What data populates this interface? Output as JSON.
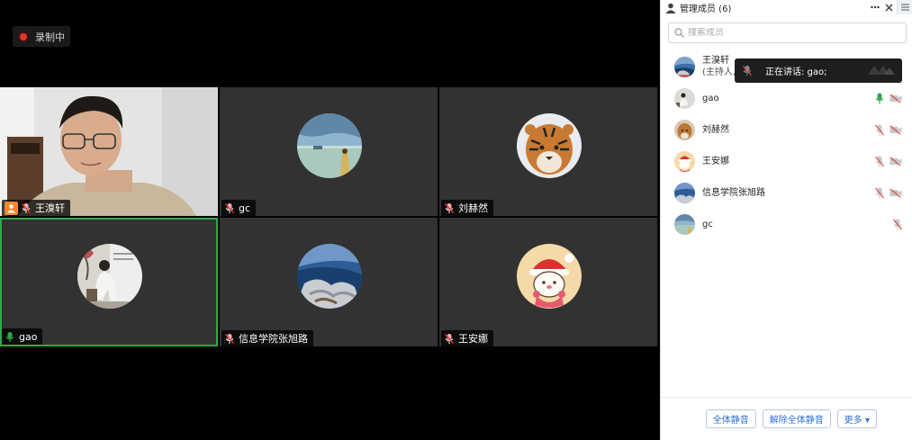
{
  "recording": {
    "label": "录制中",
    "dot_color": "#e5322d"
  },
  "tiles": [
    {
      "name": "王溴轩",
      "role": "host",
      "mic": "muted",
      "active": false
    },
    {
      "name": "gc",
      "mic": "muted",
      "active": false
    },
    {
      "name": "刘赫然",
      "mic": "muted",
      "active": false
    },
    {
      "name": "gao",
      "mic": "speaking",
      "active": true
    },
    {
      "name": "信息学院张旭路",
      "mic": "muted",
      "active": false
    },
    {
      "name": "王安娜",
      "mic": "muted",
      "active": false
    }
  ],
  "panel": {
    "title": "管理成员 (6)",
    "more_icon": "more-horizontal-icon",
    "close_icon": "close-icon",
    "menu_icon": "hamburger-menu-icon",
    "search_placeholder": "搜索成员",
    "members": [
      {
        "name": "王溴轩",
        "sub": "(主持人, 我)",
        "mic": "muted",
        "video": "off"
      },
      {
        "name": "gao",
        "mic": "speaking",
        "video": "off"
      },
      {
        "name": "刘赫然",
        "mic": "muted",
        "video": "off"
      },
      {
        "name": "王安娜",
        "mic": "muted",
        "video": "off"
      },
      {
        "name": "信息学院张旭路",
        "mic": "muted",
        "video": "off"
      },
      {
        "name": "gc",
        "mic": "muted"
      }
    ],
    "tooltip": {
      "text": "正在讲话: gao;"
    },
    "footer": {
      "mute_all": "全体静音",
      "unmute_all": "解除全体静音",
      "more": "更多 ▾"
    }
  },
  "colors": {
    "accent": "#2d6fd2",
    "speaking": "#2fa94a",
    "muted": "#d9534f",
    "host": "#f5872a"
  }
}
